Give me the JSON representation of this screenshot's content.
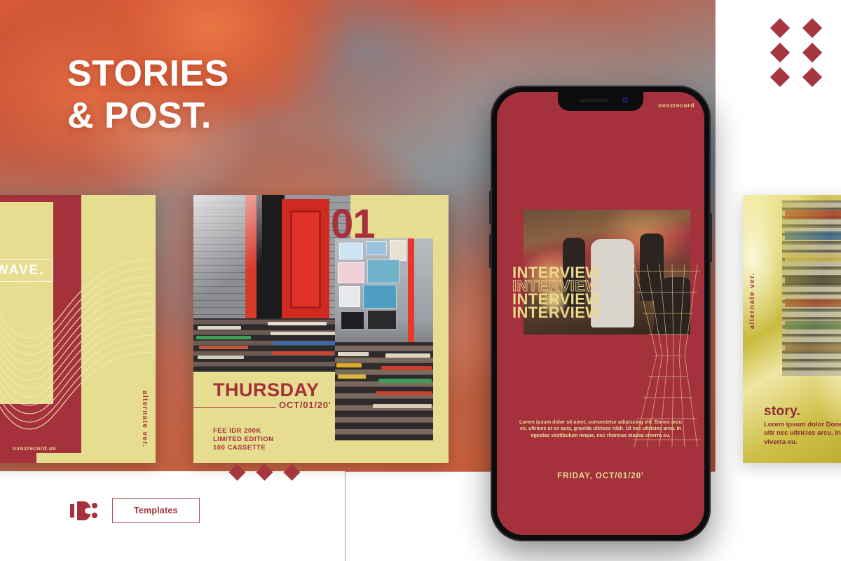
{
  "hero": {
    "title_line1": "STORIES",
    "title_line2": "& POST."
  },
  "card_king_wave": {
    "title": "KING WAVE.",
    "sub_line1": "re-order now \"deluxe edition\"",
    "sub_line2": "hit us by direct message",
    "url": "ovozrecord.us",
    "alternate_label": "alternate ver."
  },
  "card_thursday": {
    "number": "01",
    "day": "THURSDAY",
    "date": "OCT/01/20'",
    "meta_line1": "FEE IDR 200K",
    "meta_line2": "LIMITED EDITION",
    "meta_line3": "100 CASSETTE"
  },
  "phone": {
    "brand": "ovozrecord",
    "interview_1": "INTERVIEW",
    "interview_2": "INTERVIEW",
    "interview_3": "INTERVIEW",
    "interview_4": "INTERVIEW",
    "lorem": "Lorem ipsum dolor sit amet, consectetur adipiscing elit. Donec arcu ex, ultrices at ex quis, gravida ultrices nibh. Ut nec ultricies arcu. In egestas vestibulum neque, nec rhoncus massa viverra eu.",
    "date": "FRIDAY, OCT/01/20'"
  },
  "card_story": {
    "alternate_label": "alternate ver.",
    "title": "story.",
    "body": "Lorem ipsum dolor Donec arcu ex, ultr nec ultricies arcu. In massa viverra eu."
  },
  "footer": {
    "logo_name": "ovozrecord-logo",
    "templates_label": "Templates"
  },
  "colors": {
    "red": "#a5313c",
    "yellow": "#e6dd90",
    "white": "#ffffff",
    "diamond": "#a63741",
    "hairline": "#c9707a"
  }
}
